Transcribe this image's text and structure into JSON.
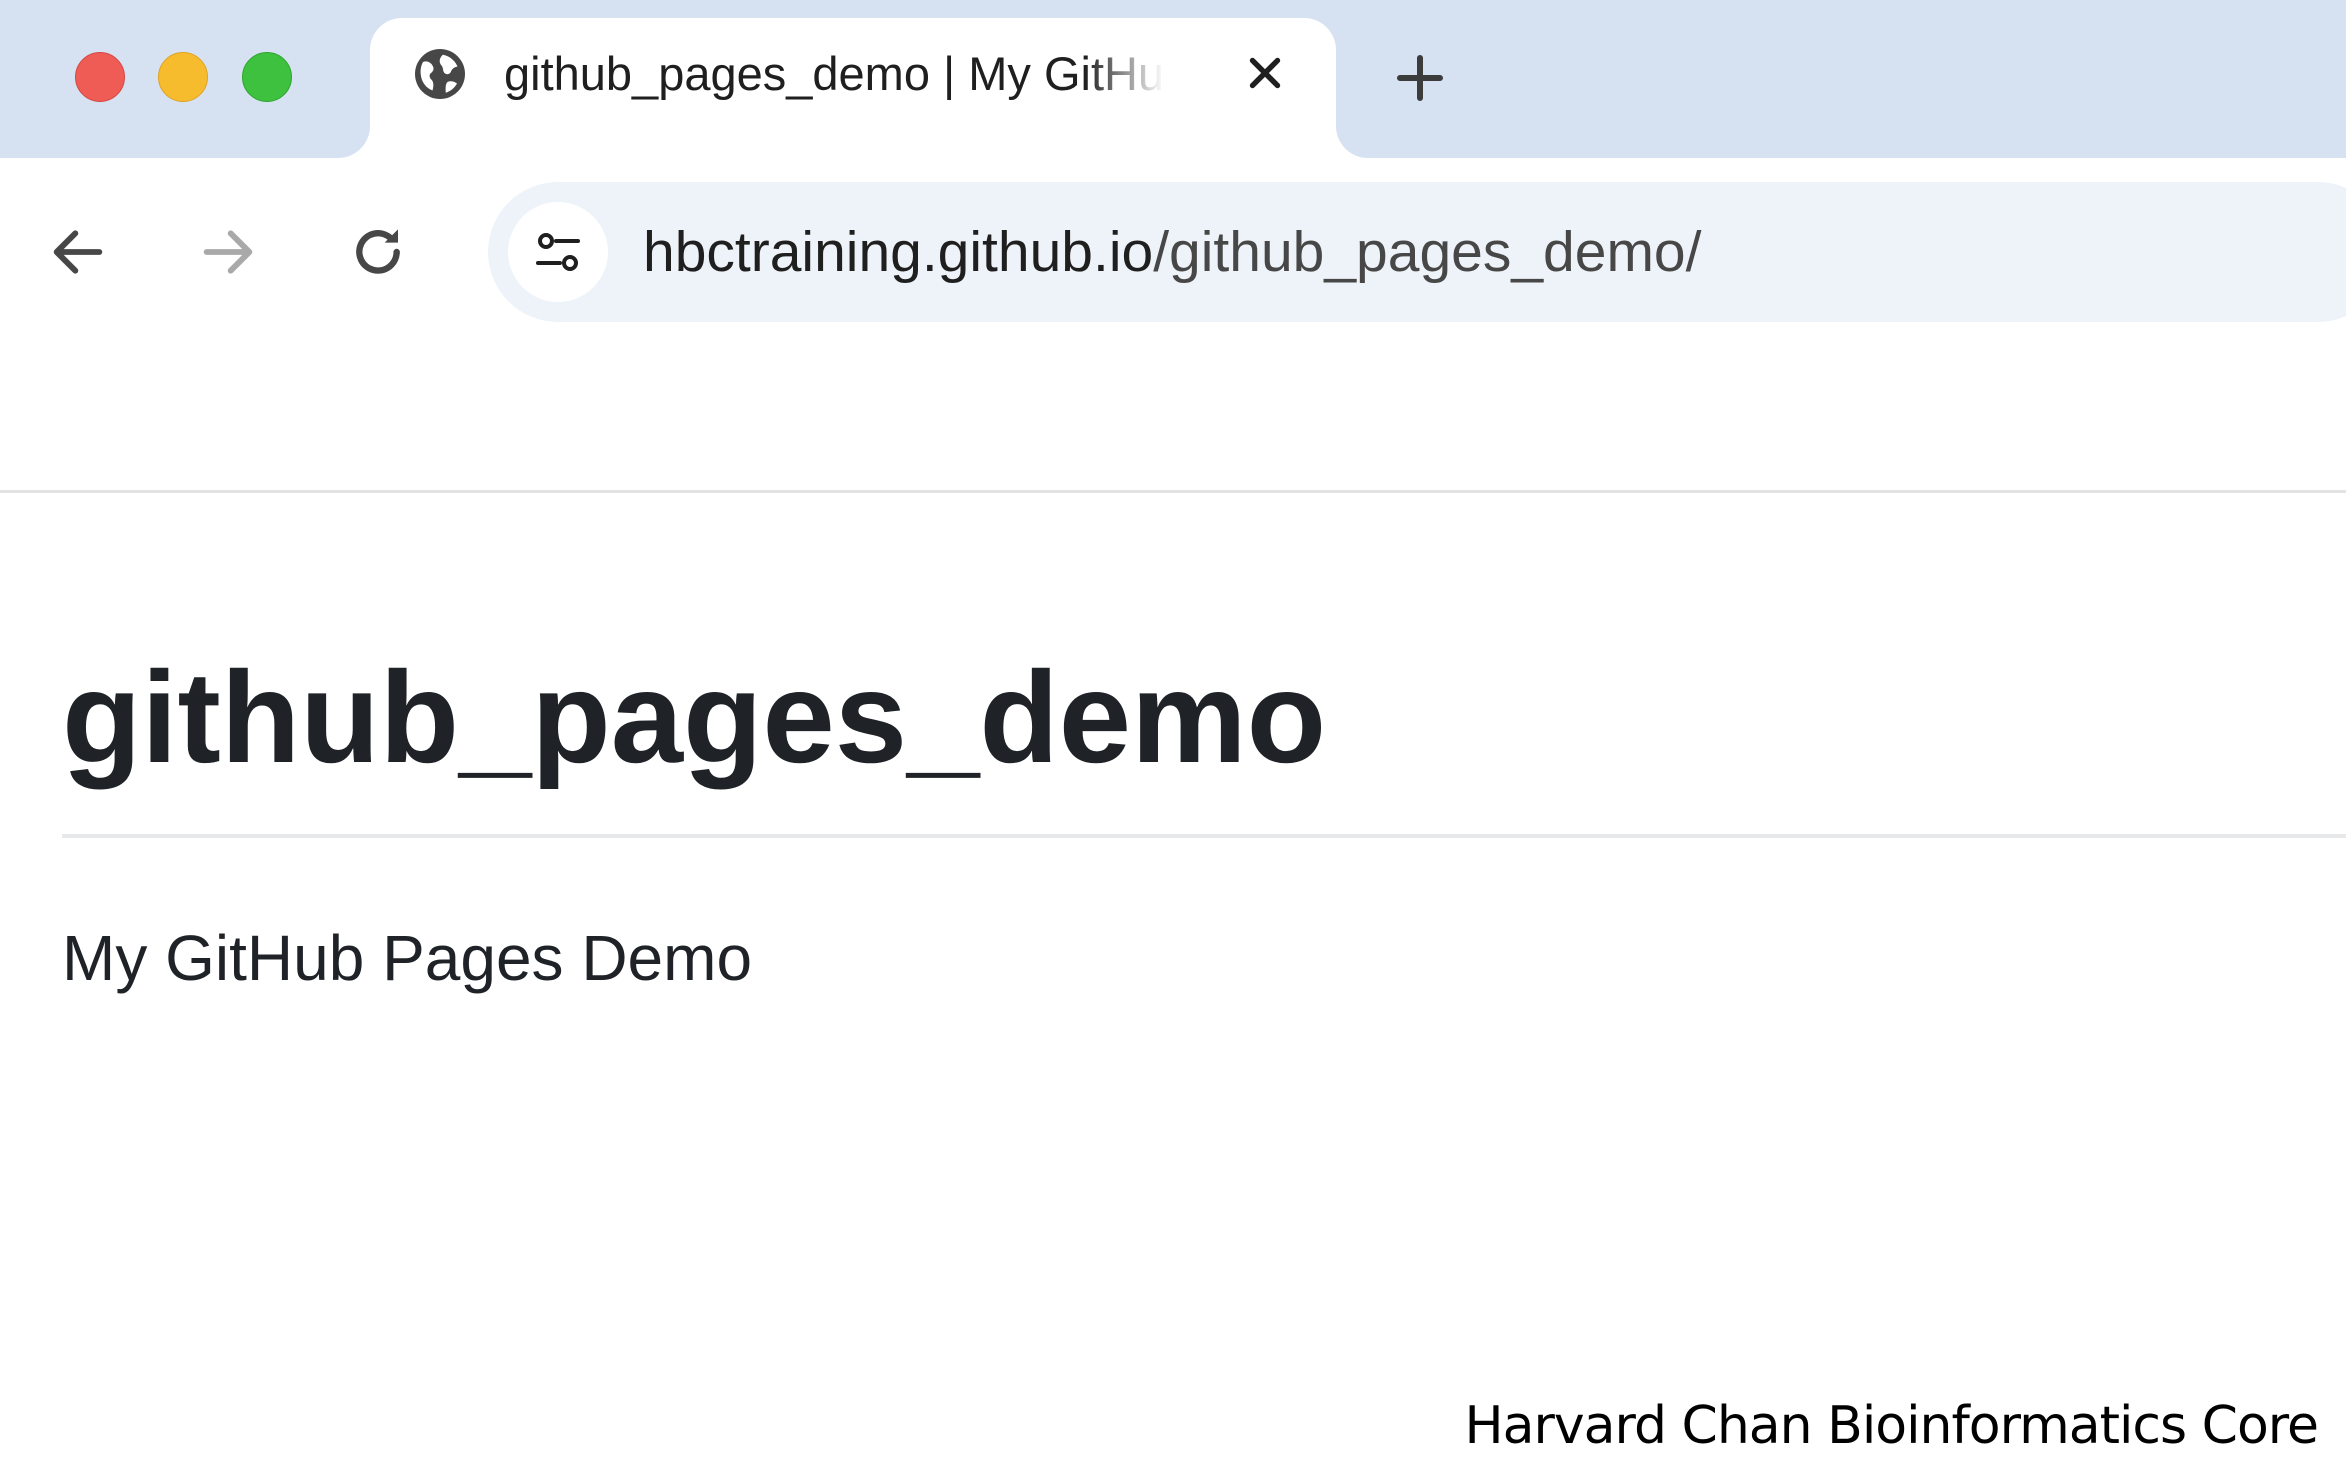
{
  "browser": {
    "tab": {
      "title": "github_pages_demo | My GitHub Pages Demo",
      "favicon": "globe-icon"
    },
    "new_tab_icon": "plus-icon",
    "close_tab_icon": "close-icon",
    "window_controls": {
      "close_color": "#ee5c55",
      "minimize_color": "#f7bc2e",
      "maximize_color": "#3ec13f"
    },
    "nav": {
      "back_icon": "arrow-left-icon",
      "forward_icon": "arrow-right-icon",
      "reload_icon": "reload-icon"
    },
    "address_bar": {
      "site_info_icon": "tune-icon",
      "host": "hbctraining.github.io",
      "path": "/github_pages_demo/"
    }
  },
  "page": {
    "title": "github_pages_demo",
    "description": "My GitHub Pages Demo"
  },
  "watermark": "Harvard Chan Bioinformatics Core",
  "colors": {
    "tabstrip_bg": "#d6e2f2",
    "omnibox_bg": "#eef3f9",
    "heading_text": "#1f2328"
  }
}
